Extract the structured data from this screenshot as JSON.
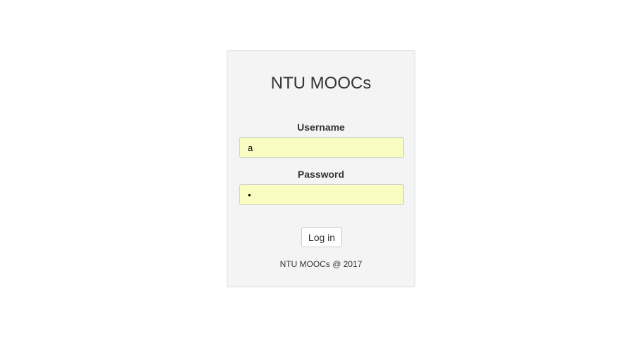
{
  "login": {
    "title": "NTU MOOCs",
    "username_label": "Username",
    "username_value": "a",
    "password_label": "Password",
    "password_value": "a",
    "submit_label": "Log in",
    "footer": "NTU MOOCs @ 2017"
  },
  "colors": {
    "card_background": "#f4f4f4",
    "input_autofill_background": "#fafdc2",
    "border": "#dddddd"
  }
}
